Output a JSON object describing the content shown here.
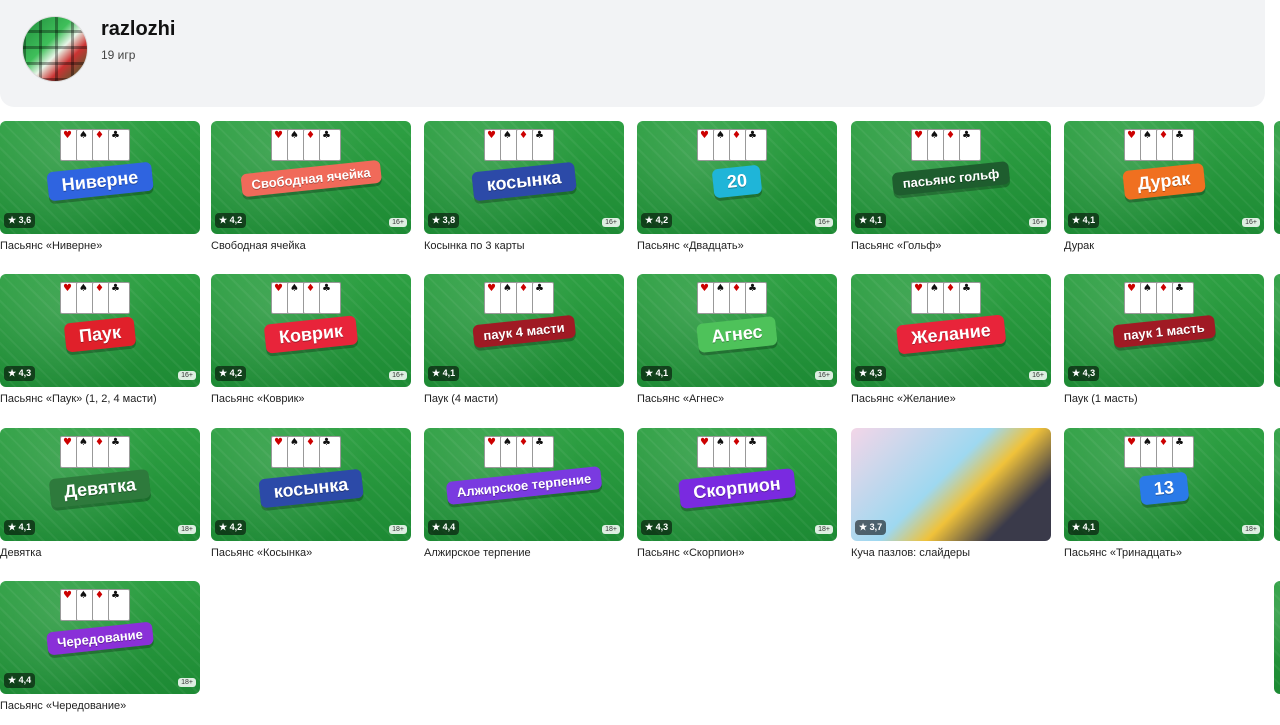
{
  "developer": {
    "name": "razlozhi",
    "games_count": "19 игр"
  },
  "colors": {
    "tile_green": "#1d8a34"
  },
  "games": [
    {
      "title": "Пасьянс «Ниверне»",
      "rating": "★ 3,6",
      "age": "",
      "banner": "Ниверне",
      "banner_color": "#2f64e0"
    },
    {
      "title": "Свободная ячейка",
      "rating": "★ 4,2",
      "age": "16+",
      "banner": "Свободная ячейка",
      "banner_color": "#f06a5a"
    },
    {
      "title": "Косынка по 3 карты",
      "rating": "★ 3,8",
      "age": "16+",
      "banner": "косынка",
      "banner_color": "#2c4aa8"
    },
    {
      "title": "Пасьянс «Двадцать»",
      "rating": "★ 4,2",
      "age": "16+",
      "banner": "20",
      "banner_color": "#1fb5d8"
    },
    {
      "title": "Пасьянс «Гольф»",
      "rating": "★ 4,1",
      "age": "16+",
      "banner": "пасьянс гольф",
      "banner_color": "#1e5d2e"
    },
    {
      "title": "Дурак",
      "rating": "★ 4,1",
      "age": "16+",
      "banner": "Дурак",
      "banner_color": "#f07020"
    },
    {
      "title": "Пасьянс «Паук» (1, 2, 4 масти)",
      "rating": "★ 4,3",
      "age": "16+",
      "banner": "Паук",
      "banner_color": "#e0202a"
    },
    {
      "title": "Пасьянс «Коврик»",
      "rating": "★ 4,2",
      "age": "16+",
      "banner": "Коврик",
      "banner_color": "#e8243a"
    },
    {
      "title": "Паук (4 масти)",
      "rating": "★ 4,1",
      "age": "",
      "banner": "паук 4 масти",
      "banner_color": "#a01a24"
    },
    {
      "title": "Пасьянс «Агнес»",
      "rating": "★ 4,1",
      "age": "16+",
      "banner": "Агнес",
      "banner_color": "#4ec25a"
    },
    {
      "title": "Пасьянс «Желание»",
      "rating": "★ 4,3",
      "age": "16+",
      "banner": "Желание",
      "banner_color": "#e8243a"
    },
    {
      "title": "Паук (1 масть)",
      "rating": "★ 4,3",
      "age": "",
      "banner": "паук 1 масть",
      "banner_color": "#a01a24"
    },
    {
      "title": "Девятка",
      "rating": "★ 4,1",
      "age": "18+",
      "banner": "Девятка",
      "banner_color": "#2e7a3c"
    },
    {
      "title": "Пасьянс «Косынка»",
      "rating": "★ 4,2",
      "age": "18+",
      "banner": "косынка",
      "banner_color": "#2c4aa8"
    },
    {
      "title": "Алжирское терпение",
      "rating": "★ 4,4",
      "age": "18+",
      "banner": "Алжирское терпение",
      "banner_color": "#7a3ae0"
    },
    {
      "title": "Пасьянс «Скорпион»",
      "rating": "★ 4,3",
      "age": "18+",
      "banner": "Скорпион",
      "banner_color": "#7a2ae0"
    },
    {
      "title": "Куча пазлов: слайдеры",
      "rating": "★ 3,7",
      "age": "",
      "banner": "",
      "banner_color": ""
    },
    {
      "title": "Пасьянс «Тринадцать»",
      "rating": "★ 4,1",
      "age": "18+",
      "banner": "13",
      "banner_color": "#2a7ae8"
    },
    {
      "title": "Пасьянс «Чередование»",
      "rating": "★ 4,4",
      "age": "18+",
      "banner": "Чередование",
      "banner_color": "#8a30d8"
    }
  ]
}
